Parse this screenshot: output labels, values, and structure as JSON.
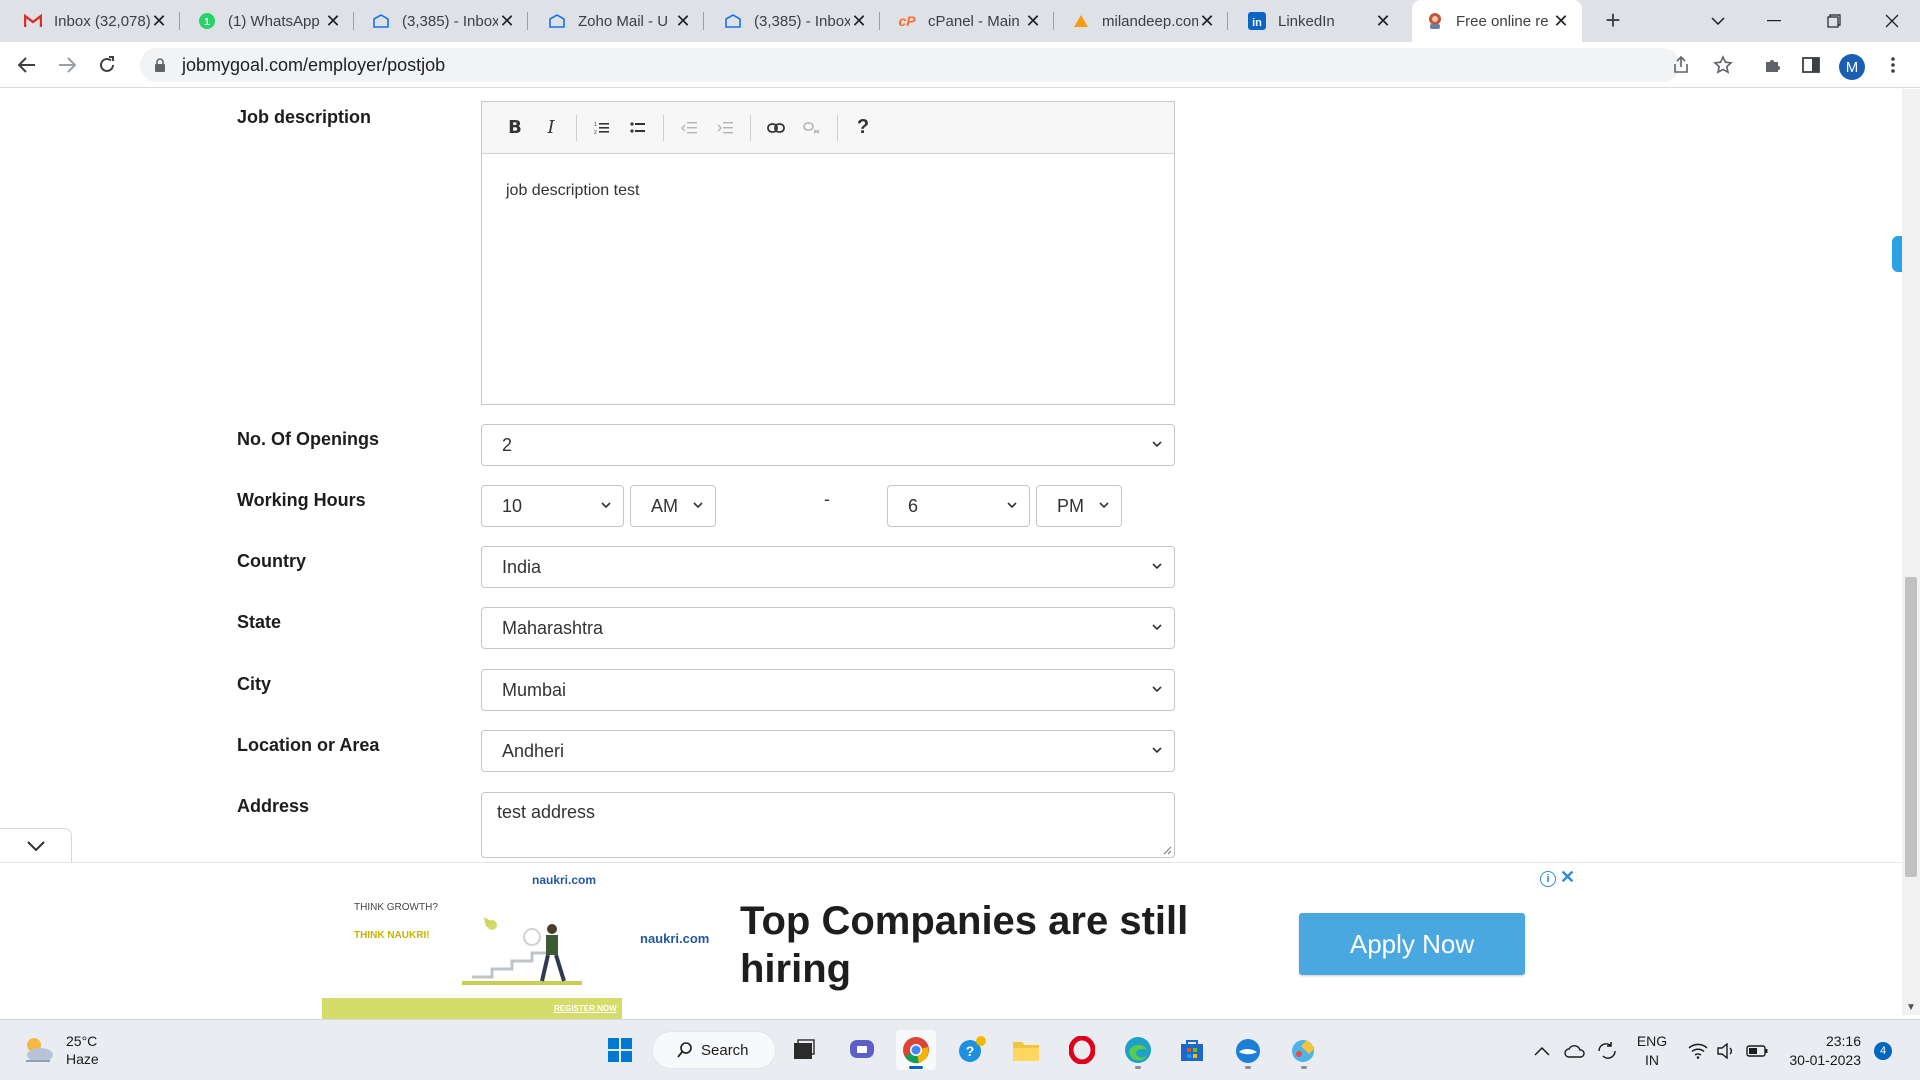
{
  "browser": {
    "tabs": [
      {
        "title": "Inbox (32,078)",
        "icon": "gmail-icon"
      },
      {
        "title": "(1) WhatsApp",
        "icon": "whatsapp-icon"
      },
      {
        "title": "(3,385) - Inbox",
        "icon": "mail-icon"
      },
      {
        "title": "Zoho Mail - U",
        "icon": "mail-icon"
      },
      {
        "title": "(3,385) - Inbox",
        "icon": "mail-icon"
      },
      {
        "title": "cPanel - Main",
        "icon": "cpanel-icon"
      },
      {
        "title": "milandeep.com",
        "icon": "phpmyadmin-icon"
      },
      {
        "title": "LinkedIn",
        "icon": "linkedin-icon"
      },
      {
        "title": "Free online re",
        "icon": "tool-icon",
        "active": true
      }
    ],
    "url": "jobmygoal.com/employer/postjob",
    "profile_initial": "M"
  },
  "form": {
    "job_description": {
      "label": "Job description",
      "value": "job description test",
      "toolbar": [
        "bold",
        "italic",
        "numbered-list",
        "bulleted-list",
        "outdent",
        "indent",
        "link",
        "unlink",
        "help"
      ]
    },
    "openings": {
      "label": "No. Of Openings",
      "value": "2"
    },
    "working_hours": {
      "label": "Working Hours",
      "from_hour": "10",
      "from_ampm": "AM",
      "separator": "-",
      "to_hour": "6",
      "to_ampm": "PM"
    },
    "country": {
      "label": "Country",
      "value": "India"
    },
    "state": {
      "label": "State",
      "value": "Maharashtra"
    },
    "city": {
      "label": "City",
      "value": "Mumbai"
    },
    "location": {
      "label": "Location or Area",
      "value": "Andheri"
    },
    "address": {
      "label": "Address",
      "value": "test address"
    }
  },
  "ad": {
    "brand": "naukri.com",
    "tagline_1": "THINK GROWTH?",
    "tagline_2": "THINK NAUKRI!",
    "strip_text": "REGISTER NOW",
    "headline": "Top Companies are still hiring",
    "cta": "Apply Now",
    "info": "i",
    "close": "✕"
  },
  "taskbar": {
    "weather_temp": "25°C",
    "weather_desc": "Haze",
    "search_label": "Search",
    "lang_1": "ENG",
    "lang_2": "IN",
    "time": "23:16",
    "date": "30-01-2023",
    "notifications": "4"
  },
  "colors": {
    "accent": "#4aa8e1",
    "windows_blue": "#0067c0",
    "tab_strip": "#dee1e6"
  }
}
